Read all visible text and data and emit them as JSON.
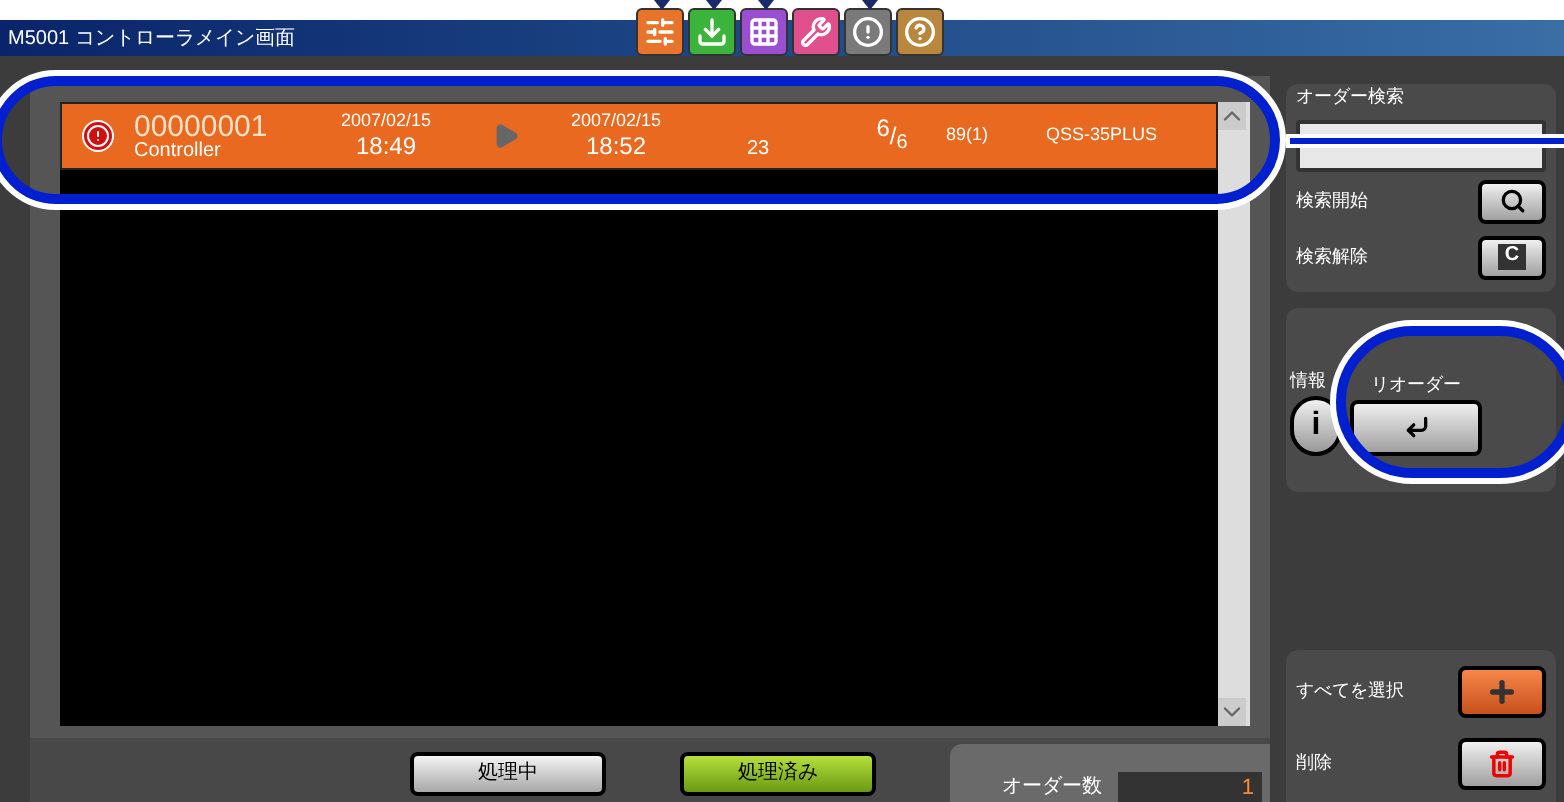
{
  "window": {
    "title": "M5001 コントローラメイン画面"
  },
  "toolbar": [
    {
      "kind": "settings",
      "color": "#e8732a",
      "marker": true
    },
    {
      "kind": "download",
      "color": "#3cb43c",
      "marker": true
    },
    {
      "kind": "grid",
      "color": "#9b4fd0",
      "marker": true
    },
    {
      "kind": "wrench",
      "color": "#e0508c",
      "marker": false
    },
    {
      "kind": "alert",
      "color": "#7a7a7a",
      "marker": true
    },
    {
      "kind": "help",
      "color": "#b8863c",
      "marker": false
    }
  ],
  "orders": [
    {
      "error": true,
      "number": "00000001",
      "name": "Controller",
      "start_date": "2007/02/15",
      "start_time": "18:49",
      "end_date": "2007/02/15",
      "end_time": "18:52",
      "column_5": "23",
      "count": "6",
      "separator": "/",
      "total": "6",
      "column_7": "89(1)",
      "model": "QSS-35PLUS"
    }
  ],
  "status_tabs": [
    {
      "label": "処理中",
      "selected": false
    },
    {
      "label": "処理済み",
      "selected": true
    }
  ],
  "order_count": {
    "label": "オーダー数",
    "value": "1"
  },
  "search": {
    "label": "オーダー検索",
    "start_label": "検索開始",
    "clear_label": "検索解除",
    "clear_key": "C"
  },
  "info": {
    "label": "情報",
    "key": "i"
  },
  "reorder": {
    "label": "リオーダー"
  },
  "select_all": {
    "label": "すべてを選択"
  },
  "delete": {
    "label": "削除"
  }
}
